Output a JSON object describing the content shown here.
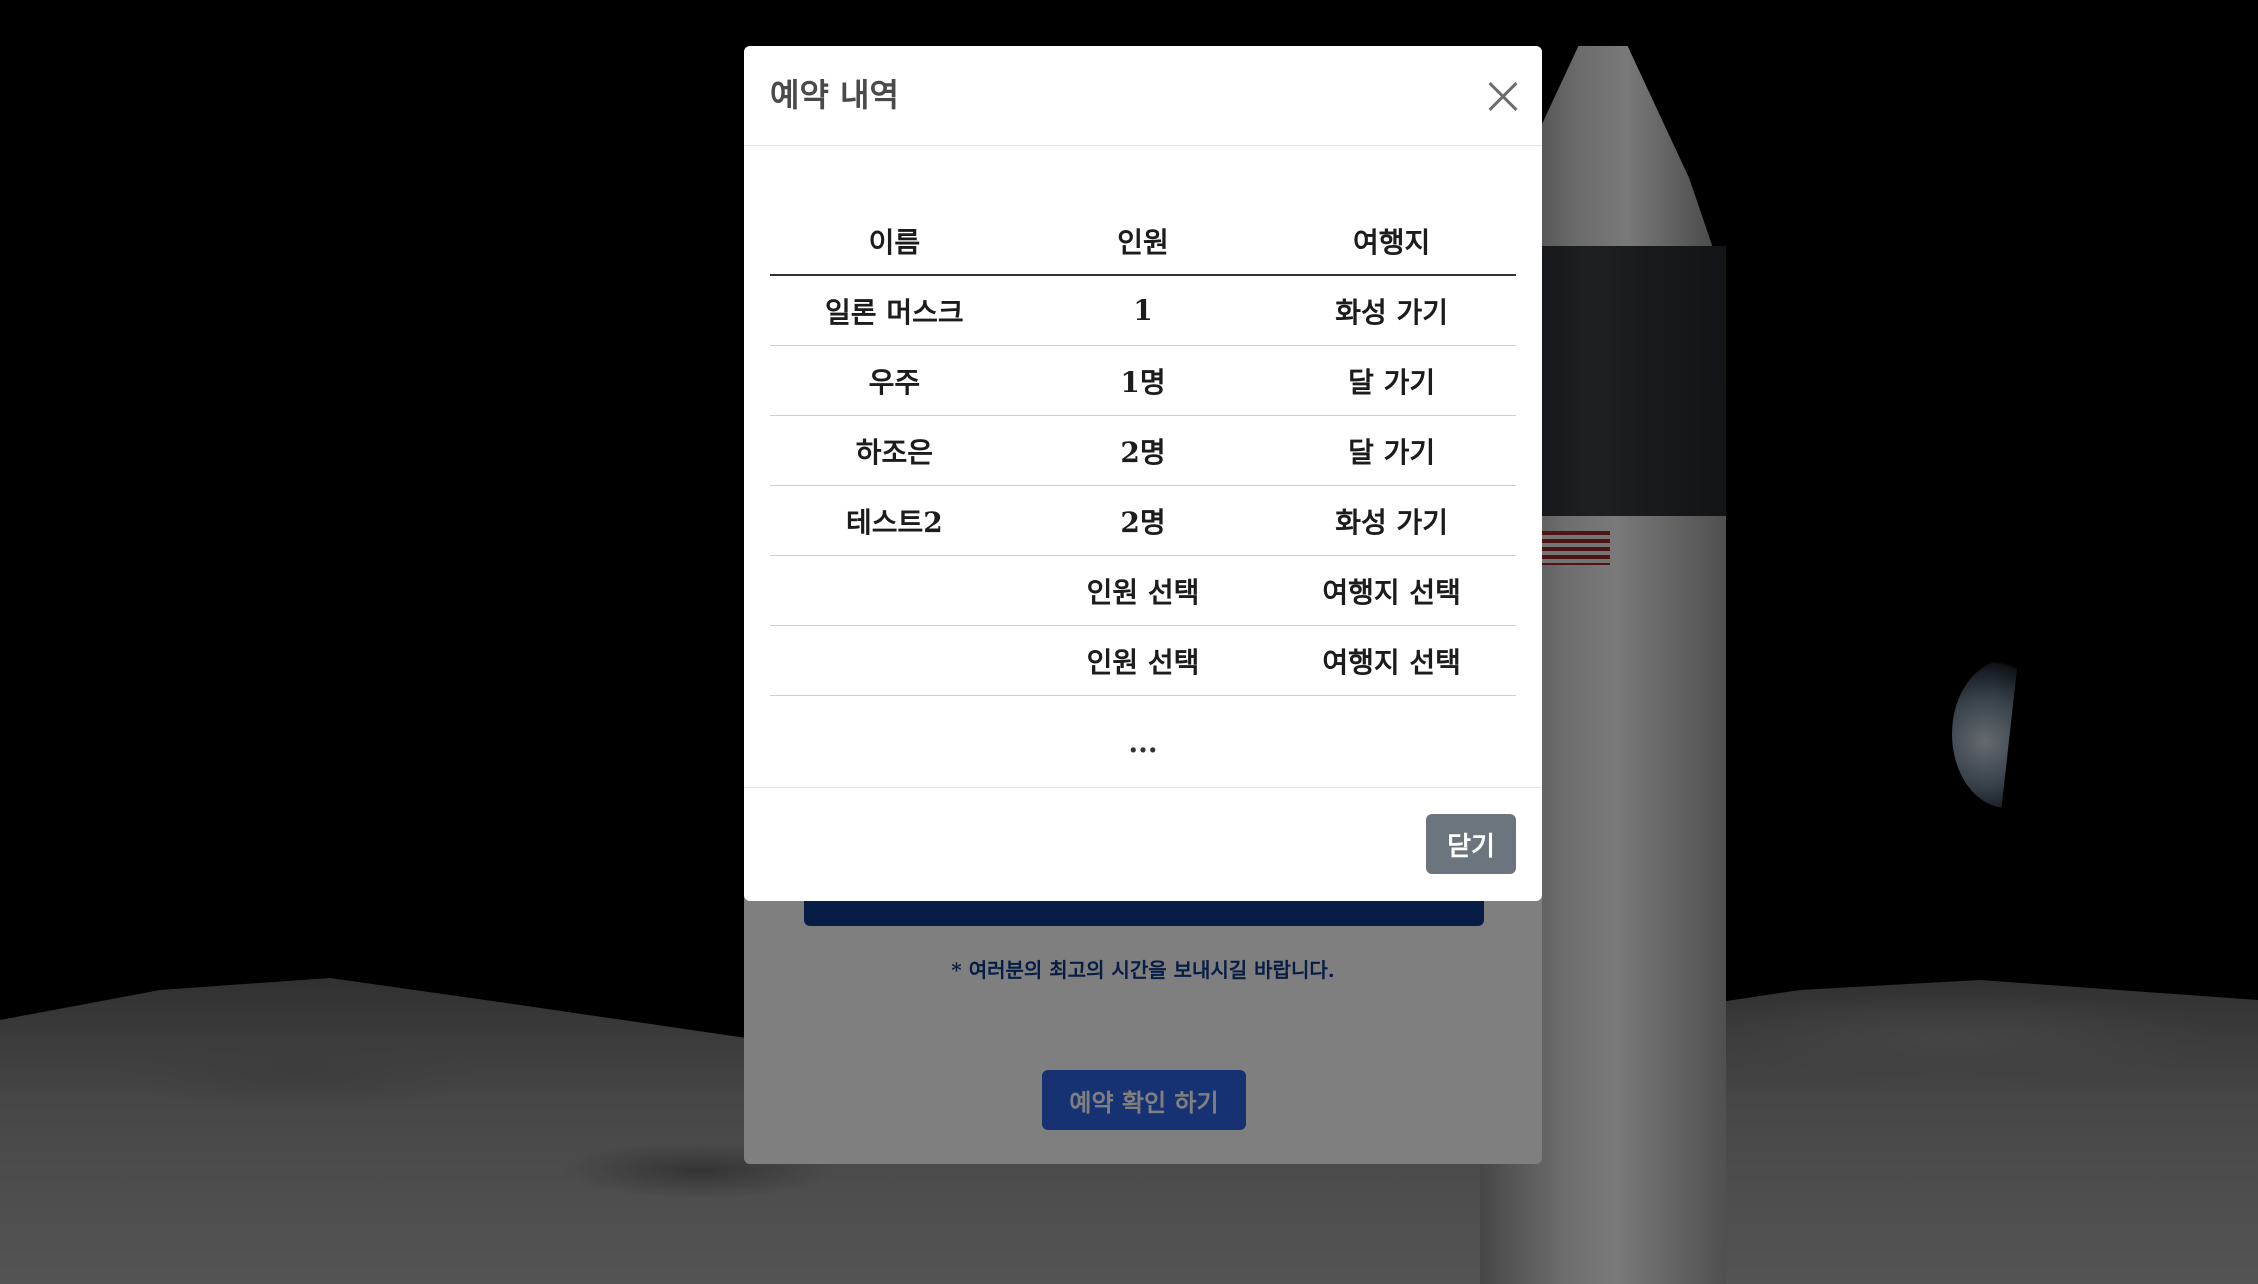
{
  "modal": {
    "title": "예약 내역",
    "columns": [
      "이름",
      "인원",
      "여행지"
    ],
    "rows": [
      [
        "일론 머스크",
        "1",
        "화성 가기"
      ],
      [
        "우주",
        "1명",
        "달 가기"
      ],
      [
        "하조은",
        "2명",
        "달 가기"
      ],
      [
        "테스트2",
        "2명",
        "화성 가기"
      ],
      [
        "",
        "인원 선택",
        "여행지 선택"
      ],
      [
        "",
        "인원 선택",
        "여행지 선택"
      ]
    ],
    "more_indicator": "...",
    "close_label": "닫기"
  },
  "background_page": {
    "note": "* 여러분의 최고의 시간을 보내시길 바랍니다.",
    "confirm_label": "예약 확인 하기"
  },
  "colors": {
    "primary_blue": "#2e64e6",
    "navy": "#0f3a8a",
    "secondary_gray": "#6c757d"
  },
  "icons": {
    "close": "close-icon"
  }
}
